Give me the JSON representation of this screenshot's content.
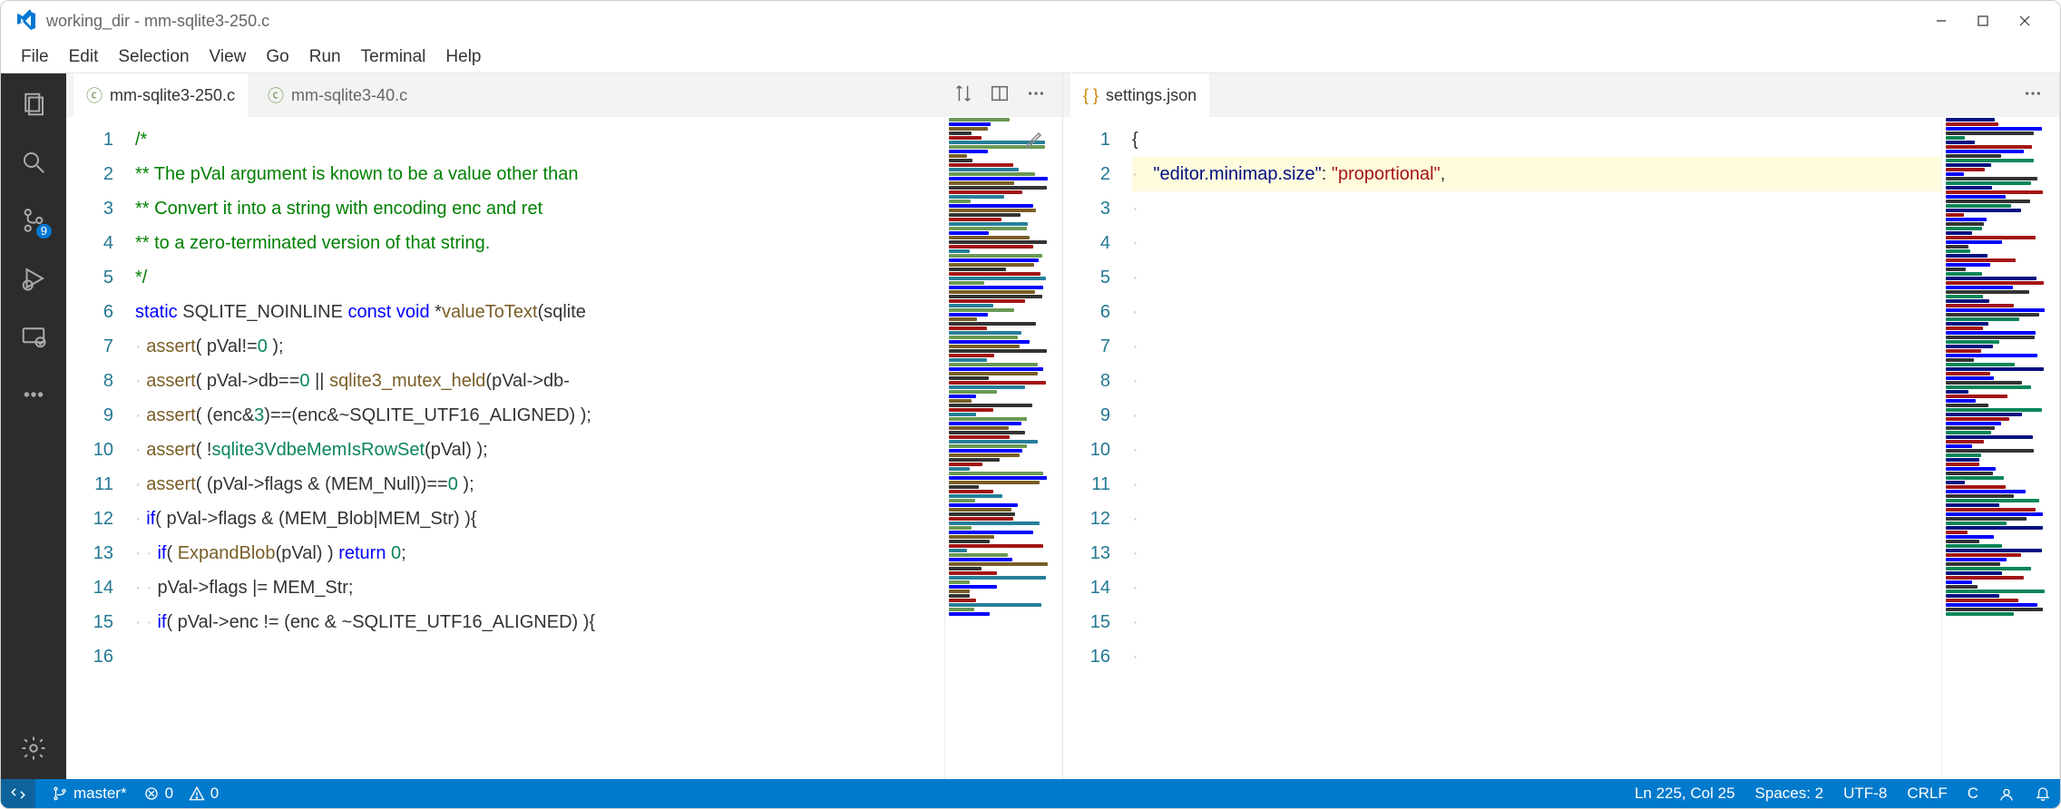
{
  "window": {
    "title": "working_dir - mm-sqlite3-250.c"
  },
  "menu": [
    "File",
    "Edit",
    "Selection",
    "View",
    "Go",
    "Run",
    "Terminal",
    "Help"
  ],
  "activity": {
    "scm_badge": "9"
  },
  "group1": {
    "tabs": [
      {
        "label": "mm-sqlite3-250.c",
        "active": true
      },
      {
        "label": "mm-sqlite3-40.c",
        "active": false
      }
    ],
    "gutter": [
      "1",
      "2",
      "3",
      "4",
      "5",
      "6",
      "7",
      "8",
      "9",
      "10",
      "11",
      "12",
      "13",
      "14",
      "15",
      "16"
    ],
    "code_raw": [
      "",
      "/*",
      "** The pVal argument is known to be a value other than",
      "** Convert it into a string with encoding enc and ret",
      "** to a zero-terminated version of that string.",
      "*/",
      {
        "type": "sig",
        "tokens": [
          "static",
          " SQLITE_NOINLINE ",
          "const",
          " ",
          "void",
          " *",
          "valueToText",
          "(sqlite"
        ]
      },
      {
        "type": "call",
        "indent": 1,
        "tokens": [
          "assert",
          "( pVal!=",
          "0",
          " );"
        ]
      },
      {
        "type": "call",
        "indent": 1,
        "tokens": [
          "assert",
          "( pVal->db==",
          "0",
          " || ",
          "sqlite3_mutex_held",
          "(pVal->db-"
        ]
      },
      {
        "type": "call",
        "indent": 1,
        "tokens": [
          "assert",
          "( (enc&",
          "3",
          ")==(enc&~SQLITE_UTF16_ALIGNED) );"
        ]
      },
      {
        "type": "call",
        "indent": 1,
        "tokens": [
          "assert",
          "( !",
          "sqlite3VdbeMemIsRowSet",
          "(pVal) );"
        ]
      },
      {
        "type": "call",
        "indent": 1,
        "tokens": [
          "assert",
          "( (pVal->flags & (MEM_Null))==",
          "0",
          " );"
        ]
      },
      {
        "type": "if",
        "indent": 1,
        "tokens": [
          "if",
          "( pVal->flags & (MEM_Blob|MEM_Str) ){"
        ]
      },
      {
        "type": "ifret",
        "indent": 2,
        "tokens": [
          "if",
          "( ",
          "ExpandBlob",
          "(pVal) ) ",
          "return",
          " ",
          "0",
          ";"
        ]
      },
      {
        "type": "stmt",
        "indent": 2,
        "text": "pVal->flags |= MEM_Str;"
      },
      {
        "type": "if",
        "indent": 2,
        "tokens": [
          "if",
          "( pVal->enc != (enc & ~SQLITE_UTF16_ALIGNED) ){"
        ]
      }
    ]
  },
  "group2": {
    "tabs": [
      {
        "label": "settings.json",
        "active": true
      }
    ],
    "gutter": [
      "1",
      "2",
      "3",
      "4",
      "5",
      "6",
      "7",
      "8",
      "9",
      "10",
      "11",
      "12",
      "13",
      "14",
      "15",
      "16"
    ],
    "json_key": "\"editor.minimap.size\"",
    "json_val": "\"proportional\"",
    "brace": "{"
  },
  "status": {
    "branch": "master*",
    "errors": "0",
    "warnings": "0",
    "lncol": "Ln 225, Col 25",
    "spaces": "Spaces: 2",
    "encoding": "UTF-8",
    "eol": "CRLF",
    "lang": "C"
  }
}
